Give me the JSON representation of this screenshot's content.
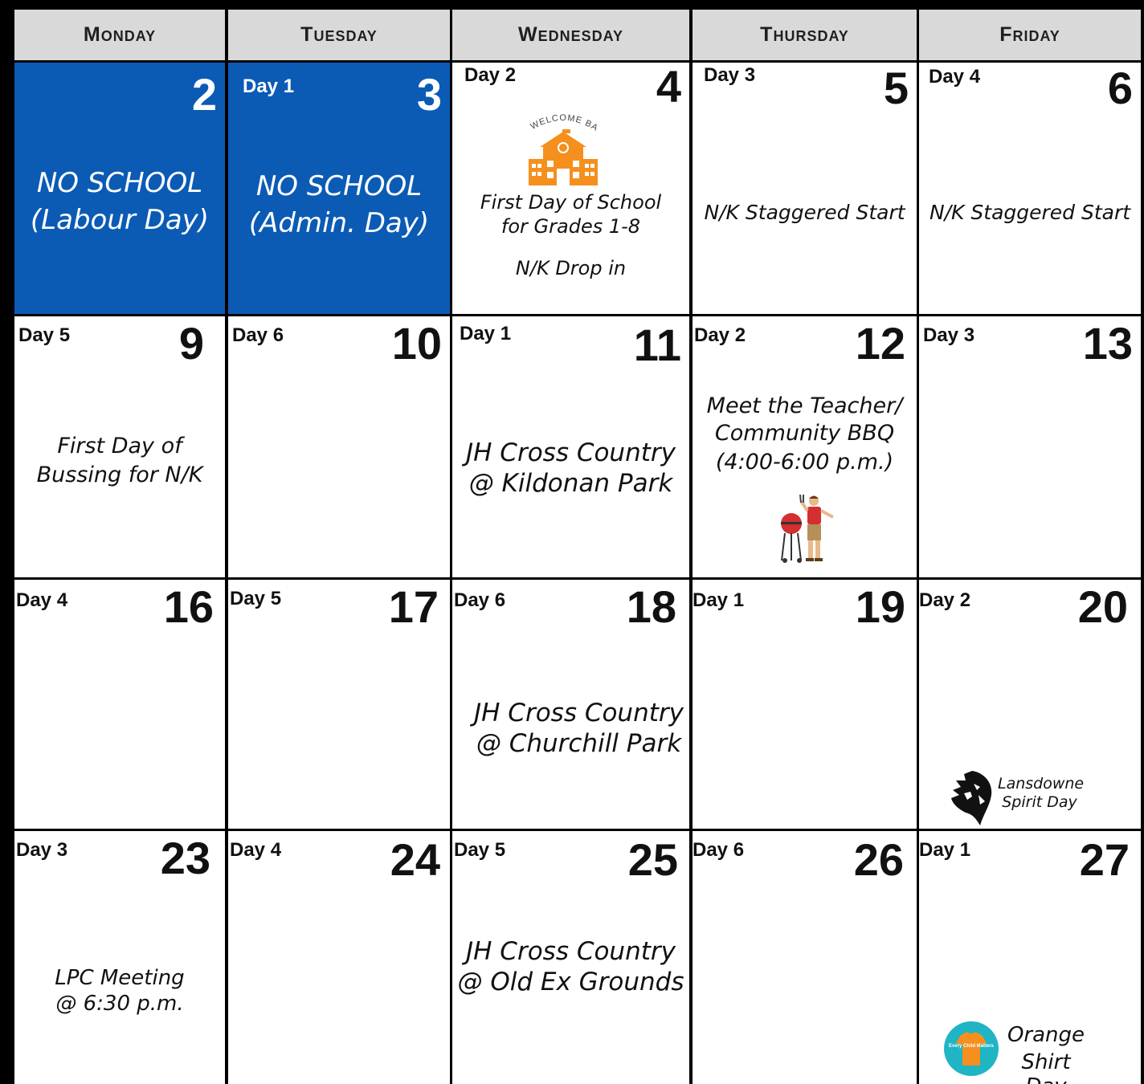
{
  "headers": [
    "Monday",
    "Tuesday",
    "Wednesday",
    "Thursday",
    "Friday"
  ],
  "weeks": [
    [
      {
        "date": "2",
        "day": "",
        "events": [
          "NO SCHOOL",
          "(Labour Day)"
        ],
        "highlight": true
      },
      {
        "date": "3",
        "day": "Day 1",
        "events": [
          "NO SCHOOL",
          "(Admin. Day)"
        ],
        "highlight": true
      },
      {
        "date": "4",
        "day": "Day 2",
        "events": [
          "First Day of School",
          "for Grades 1-8",
          "N/K Drop in"
        ],
        "image": "welcome-back-school-icon",
        "image_text": "WELCOME BACK"
      },
      {
        "date": "5",
        "day": "Day 3",
        "events": [
          "N/K Staggered Start"
        ]
      },
      {
        "date": "6",
        "day": "Day 4",
        "events": [
          "N/K Staggered Start"
        ]
      }
    ],
    [
      {
        "date": "9",
        "day": "Day 5",
        "events": [
          "First Day of",
          "Bussing for N/K"
        ]
      },
      {
        "date": "10",
        "day": "Day 6",
        "events": []
      },
      {
        "date": "11",
        "day": "Day 1",
        "events": [
          "JH Cross Country",
          "@ Kildonan Park"
        ]
      },
      {
        "date": "12",
        "day": "Day 2",
        "events": [
          "Meet the Teacher/",
          "Community BBQ",
          "(4:00-6:00 p.m.)"
        ],
        "image": "bbq-grill-icon"
      },
      {
        "date": "13",
        "day": "Day 3",
        "events": []
      }
    ],
    [
      {
        "date": "16",
        "day": "Day 4",
        "events": []
      },
      {
        "date": "17",
        "day": "Day 5",
        "events": []
      },
      {
        "date": "18",
        "day": "Day 6",
        "events": [
          "JH Cross Country",
          "@ Churchill Park"
        ]
      },
      {
        "date": "19",
        "day": "Day 1",
        "events": []
      },
      {
        "date": "20",
        "day": "Day 2",
        "events": [
          "Lansdowne",
          "Spirit Day"
        ],
        "image": "lion-icon"
      }
    ],
    [
      {
        "date": "23",
        "day": "Day 3",
        "events": [
          "LPC Meeting",
          "@ 6:30 p.m."
        ]
      },
      {
        "date": "24",
        "day": "Day 4",
        "events": []
      },
      {
        "date": "25",
        "day": "Day 5",
        "events": [
          "JH Cross Country",
          "@ Old Ex Grounds"
        ]
      },
      {
        "date": "26",
        "day": "Day 6",
        "events": []
      },
      {
        "date": "27",
        "day": "Day 1",
        "events": [
          "Orange",
          "Shirt Day"
        ],
        "image": "orange-shirt-icon",
        "image_text": "Every Child Matters"
      }
    ]
  ],
  "colors": {
    "highlight": "#0b5bb5",
    "header_bg": "#d9d9d9",
    "orange": "#f5901e",
    "teal": "#1fb5c4"
  }
}
